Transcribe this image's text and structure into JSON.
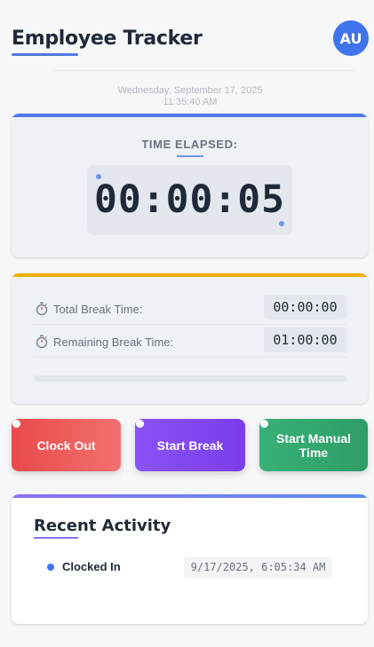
{
  "header": {
    "title": "Employee Tracker",
    "avatar_initials": "AU"
  },
  "datetime": {
    "date": "Wednesday, September 17, 2025",
    "time": "11:35:40 AM"
  },
  "timer": {
    "label": "TIME ELAPSED:",
    "value": "00:00:05"
  },
  "breaks": {
    "total_label": "Total Break Time:",
    "total_value": "00:00:00",
    "remaining_label": "Remaining Break Time:",
    "remaining_value": "01:00:00",
    "progress_fraction": 0
  },
  "actions": {
    "clock_out": "Clock Out",
    "start_break": "Start Break",
    "start_manual": "Start Manual Time"
  },
  "activity": {
    "title": "Recent Activity",
    "items": [
      {
        "label": "Clocked In",
        "time": "9/17/2025, 6:05:34 AM"
      }
    ]
  },
  "colors": {
    "primary": "#3f74ec",
    "break_accent": "#f1ad0c",
    "clock_out": "#e94a4a",
    "start_break": "#8b52f6",
    "manual_time": "#39b078",
    "activity_accent": "#8b6ff3"
  },
  "icons": {
    "break_row": "stopwatch-icon",
    "activity_bullet": "dot-icon"
  }
}
